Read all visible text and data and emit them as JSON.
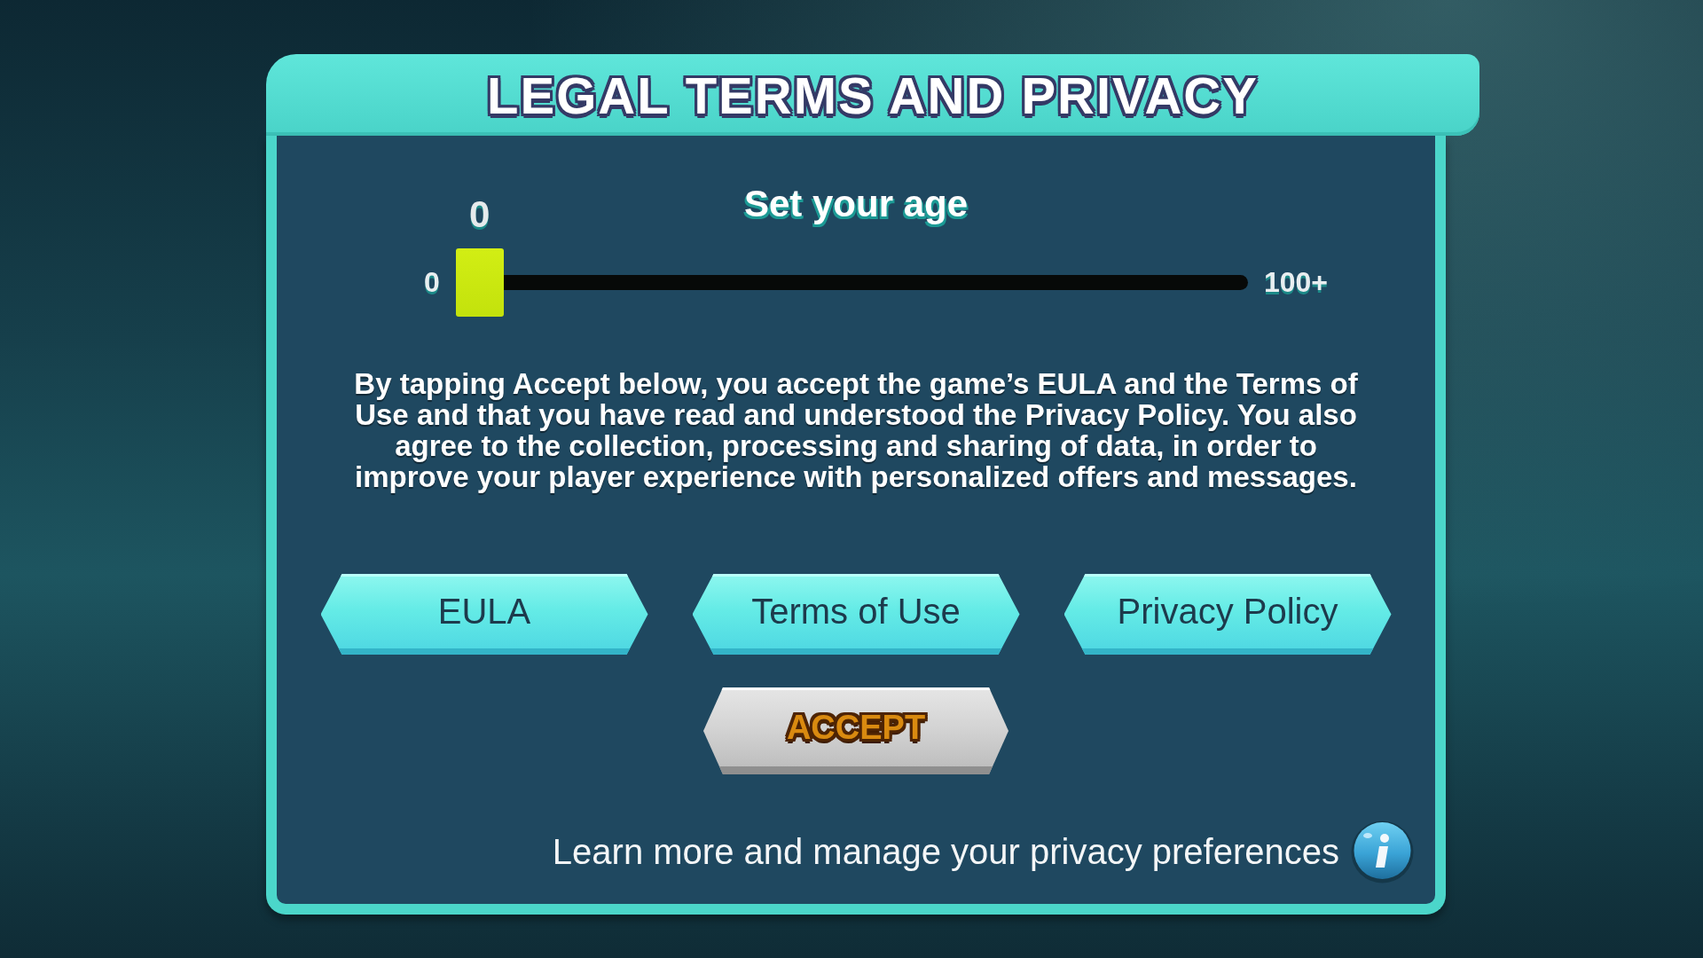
{
  "dialog": {
    "title": "LEGAL TERMS AND PRIVACY"
  },
  "age": {
    "label": "Set your age",
    "value": "0",
    "min_label": "0",
    "max_label": "100+",
    "level": 0
  },
  "notice": "By tapping Accept below, you accept the game’s EULA and the Terms of Use and that you have read and understood the Privacy Policy. You also agree to the collection, processing and sharing of data, in order to improve your player experience with personalized offers and messages.",
  "links": [
    {
      "label": "EULA"
    },
    {
      "label": "Terms of Use"
    },
    {
      "label": "Privacy Policy"
    }
  ],
  "accept": {
    "label": "ACCEPT"
  },
  "footer": {
    "text": "Learn more and manage your privacy preferences"
  }
}
